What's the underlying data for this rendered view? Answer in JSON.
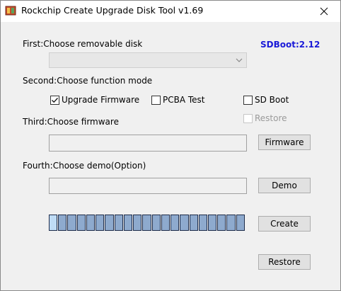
{
  "window": {
    "title": "Rockchip Create Upgrade Disk Tool v1.69",
    "close_glyph": "✕"
  },
  "step1": {
    "label": "First:Choose removable disk",
    "disk_selected": ""
  },
  "sdboot_version": "SDBoot:2.12",
  "step2": {
    "label": "Second:Choose function mode",
    "options": [
      {
        "label": "Upgrade Firmware",
        "checked": true,
        "enabled": true
      },
      {
        "label": "PCBA Test",
        "checked": false,
        "enabled": true
      },
      {
        "label": "SD Boot",
        "checked": false,
        "enabled": true
      },
      {
        "label": "Restore",
        "checked": false,
        "enabled": false
      }
    ]
  },
  "step3": {
    "label": "Third:Choose firmware",
    "firmware_path": "",
    "button_label": "Firmware"
  },
  "step4": {
    "label": "Fourth:Choose demo(Option)",
    "demo_path": "",
    "button_label": "Demo"
  },
  "progress": {
    "segments": 21,
    "active_segments": 1
  },
  "actions": {
    "create_label": "Create",
    "restore_label": "Restore"
  },
  "colors": {
    "sdboot_text": "#1a1ad8",
    "progress_fill": "#8eaace",
    "progress_active": "#bfdcf6"
  },
  "icons": {
    "app": "rockchip-app-icon",
    "close": "close-icon",
    "dropdown": "chevron-down-icon",
    "check": "checkmark-icon"
  }
}
